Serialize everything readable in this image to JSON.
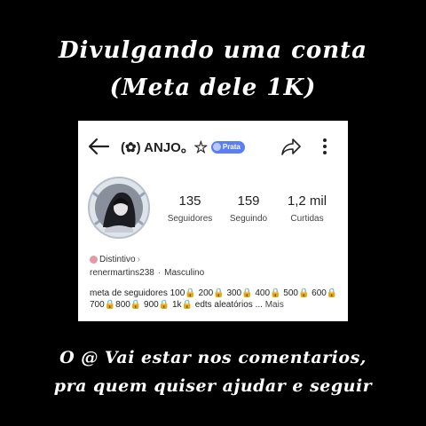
{
  "overlay": {
    "title_line1": "Divulgando uma conta",
    "title_line2": "(Meta dele 1K)",
    "caption_line1": "O @ Vai estar nos comentarios,",
    "caption_line2": "pra quem quiser ajudar e seguir"
  },
  "profile": {
    "display_name": "(✿) ANJO。☆",
    "badge_label": "Prata",
    "stats": [
      {
        "value": "135",
        "label": "Seguidores"
      },
      {
        "value": "159",
        "label": "Seguindo"
      },
      {
        "value": "1,2 mil",
        "label": "Curtidas"
      }
    ],
    "distintivo_label": "Distintivo",
    "username": "renermartins238",
    "gender": "Masculino",
    "bio_text": "meta de seguidores 100🔒 200🔒 300🔒 400🔒 500🔒 600🔒 700🔒800🔒 900🔒 1k🔒 edts  aleatórios ...",
    "bio_more": "Mais"
  },
  "colors": {
    "background": "#000000",
    "card": "#ffffff",
    "badge": "#5b7ef0"
  },
  "icons": {
    "back": "arrow-left-icon",
    "share": "share-icon",
    "more": "more-vertical-icon",
    "distintivo": "distintivo-icon"
  }
}
